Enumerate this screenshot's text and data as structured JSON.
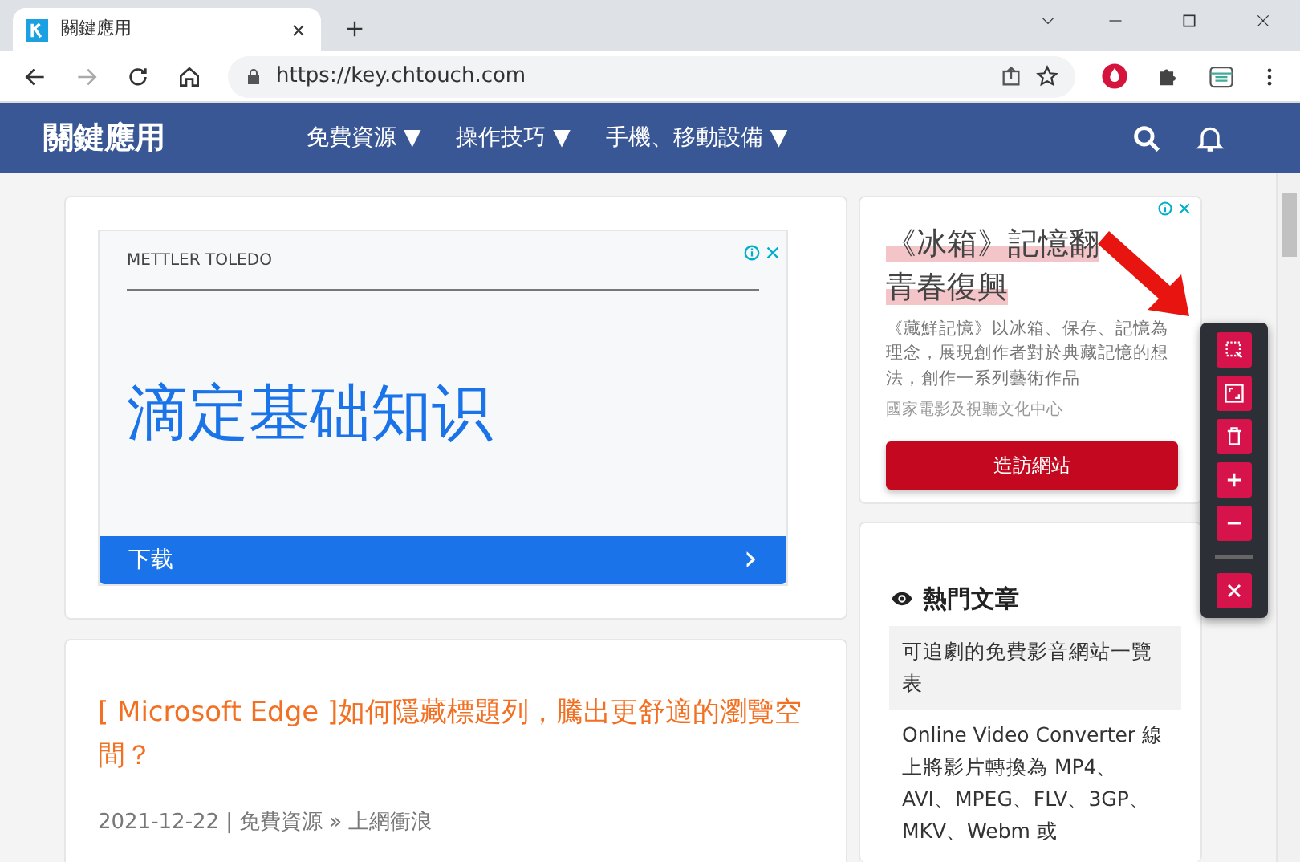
{
  "browser": {
    "tab_title": "關鍵應用",
    "url": "https://key.chtouch.com"
  },
  "site_nav": {
    "brand": "關鍵應用",
    "menu": [
      {
        "label": "免費資源 ▼"
      },
      {
        "label": "操作技巧 ▼"
      },
      {
        "label": "手機、移動設備 ▼"
      }
    ]
  },
  "ad_main": {
    "advertiser": "METTLER TOLEDO",
    "headline": "滴定基础知识",
    "cta": "下载",
    "cta_arrow": "›"
  },
  "post": {
    "title": "[ Microsoft Edge ]如何隱藏標題列，騰出更舒適的瀏覽空間？",
    "date": "2021-12-22",
    "separator": "|",
    "category": "免費資源 » 上網衝浪"
  },
  "ad_side": {
    "headline": "《冰箱》記憶翻",
    "headline_line_2": "青春復興",
    "body": "《藏鮮記憶》以冰箱、保存、記憶為理念，展現創作者對於典藏記憶的想法，創作一系列藝術作品",
    "source": "國家電影及視聽文化中心",
    "button": "造訪網站"
  },
  "popular": {
    "title": "熱門文章",
    "items": [
      {
        "text": "可追劇的免費影音網站一覽表",
        "selected": true
      },
      {
        "text": "Online Video Converter 線上將影片轉換為 MP4、AVI、MPEG、FLV、3GP、MKV、Webm 或",
        "selected": false
      }
    ]
  },
  "toolbar": {
    "buttons": [
      {
        "kind": "select"
      },
      {
        "kind": "expand"
      },
      {
        "kind": "delete"
      },
      {
        "kind": "zoom-in"
      },
      {
        "kind": "zoom-out"
      },
      {
        "kind": "divider"
      },
      {
        "kind": "close"
      }
    ]
  }
}
